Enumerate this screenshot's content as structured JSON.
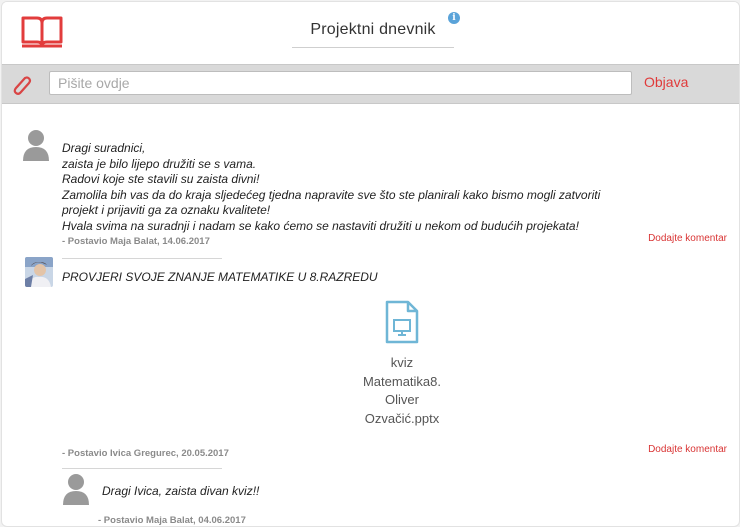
{
  "header": {
    "title": "Projektni dnevnik",
    "info_label": "i"
  },
  "composer": {
    "placeholder": "Pišite ovdje",
    "submit_label": "Objava"
  },
  "posts": [
    {
      "lines": [
        "Dragi suradnici,",
        "zaista je bilo lijepo družiti se s vama.",
        "Radovi koje ste stavili su zaista divni!",
        "Zamolila bih vas da do kraja sljedećeg tjedna napravite sve što ste planirali kako bismo mogli zatvoriti",
        "projekt i prijaviti ga za oznaku kvalitete!",
        "Hvala svima na suradnji i nadam se kako ćemo se nastaviti družiti u nekom od budućih projekata!"
      ],
      "meta": "- Postavio Maja Balat, 14.06.2017",
      "comment_label": "Dodajte komentar"
    },
    {
      "title": "PROVJERI SVOJE ZNANJE MATEMATIKE U 8.RAZREDU",
      "attachment": {
        "name_lines": [
          "kviz",
          "Matematika8.",
          "Oliver",
          "Ozvačić.pptx"
        ]
      },
      "meta": "- Postavio Ivica Gregurec, 20.05.2017",
      "comment_label": "Dodajte komentar",
      "reply": {
        "text": "Dragi Ivica, zaista divan kviz!!",
        "meta": "- Postavio Maja Balat, 04.06.2017"
      }
    }
  ],
  "colors": {
    "accent_red": "#e03a3a",
    "info_blue": "#5aa3d9",
    "file_blue": "#6fb6d6"
  }
}
